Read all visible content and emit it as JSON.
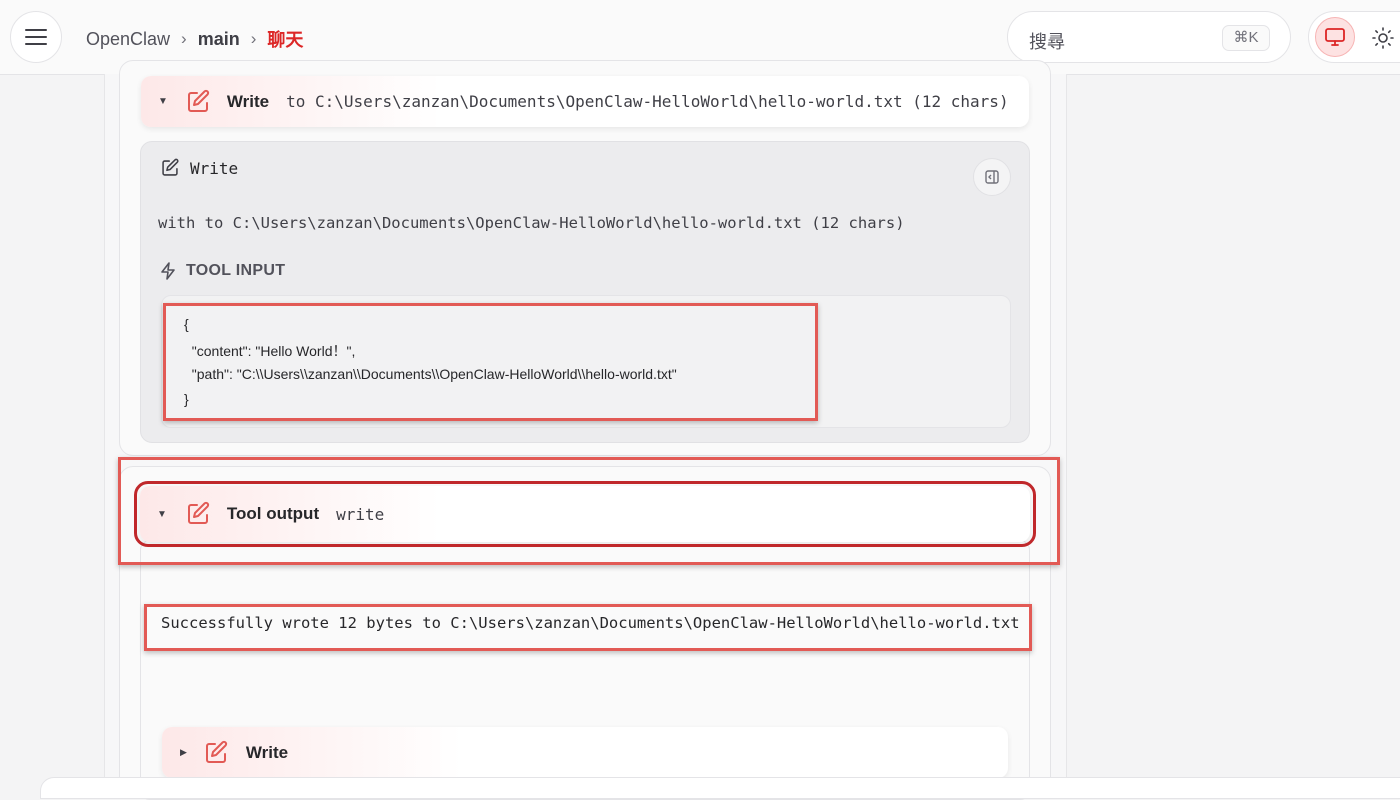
{
  "header": {
    "breadcrumb": [
      "OpenClaw",
      "main",
      "聊天"
    ],
    "search_placeholder": "搜尋",
    "search_shortcut": "⌘K"
  },
  "tool_call": {
    "name": "Write",
    "detail": "to C:\\Users\\zanzan\\Documents\\OpenClaw-HelloWorld\\hello-world.txt (12 chars)",
    "panel_title": "Write",
    "with_line": "with to C:\\Users\\zanzan\\Documents\\OpenClaw-HelloWorld\\hello-world.txt (12 chars)",
    "input_label": "TOOL INPUT",
    "input_lines": [
      "{",
      "  \"content\": \"Hello World！\",",
      "  \"path\": \"C:\\\\Users\\\\zanzan\\\\Documents\\\\OpenClaw-HelloWorld\\\\hello-world.txt\"",
      "}"
    ]
  },
  "tool_output": {
    "label": "Tool output",
    "tool": "write",
    "result": "Successfully wrote 12 bytes to C:\\Users\\zanzan\\Documents\\OpenClaw-HelloWorld\\hello-world.txt"
  },
  "next_call": {
    "name": "Write"
  },
  "colors": {
    "accent": "#dc2626",
    "highlight_box": "#e25a55"
  }
}
